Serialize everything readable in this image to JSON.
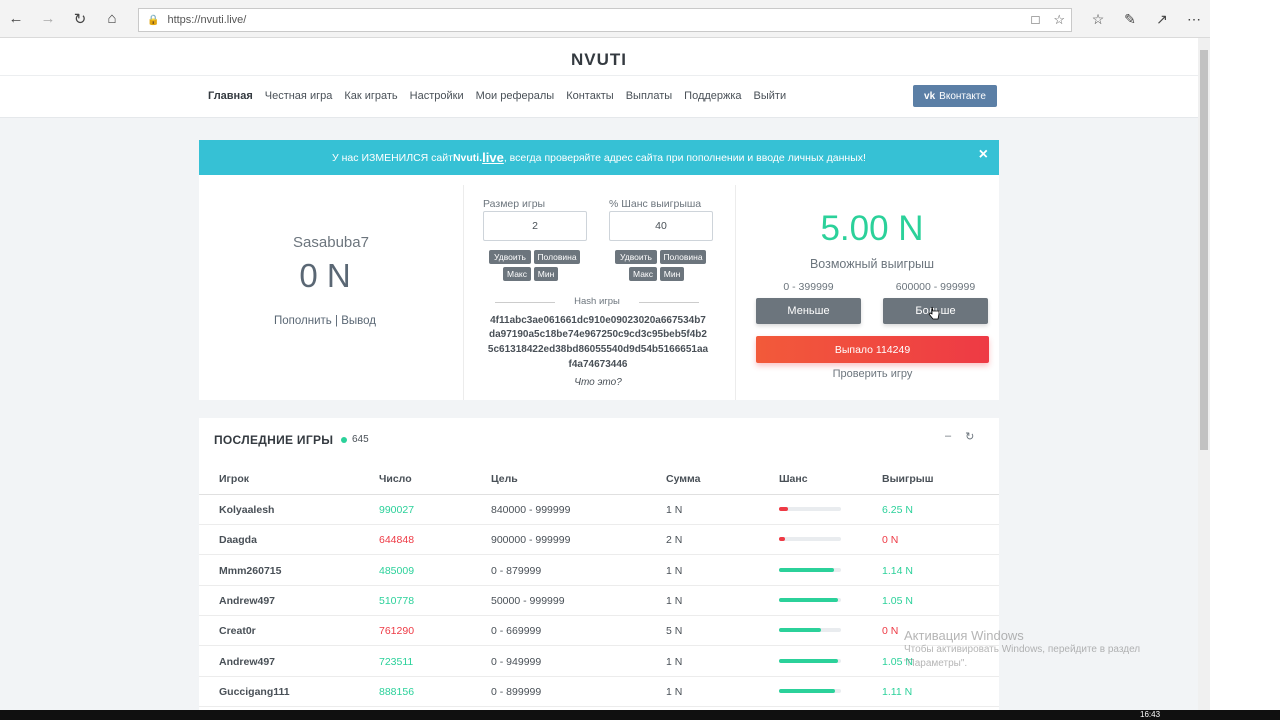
{
  "browser": {
    "url": "https://nvuti.live/",
    "back_icon": "arrow-left",
    "forward_icon": "arrow-right",
    "refresh_icon": "refresh",
    "home_icon": "home"
  },
  "site": {
    "logo": "NVUTI",
    "menu": [
      "Главная",
      "Честная игра",
      "Как играть",
      "Настройки",
      "Мои рефералы",
      "Контакты",
      "Выплаты",
      "Поддержка",
      "Выйти"
    ],
    "vk_label": "Вконтакте"
  },
  "alert": {
    "before": "У нас ИЗМЕНИЛСЯ сайт ",
    "site_a": "Nvuti.",
    "site_b": "live",
    "after": ", всегда проверяйте адрес сайта при пополнении и вводе личных данных!",
    "close": "×"
  },
  "user": {
    "name": "Sasabuba7",
    "balance": "0 N",
    "deposit": "Пополнить",
    "separator": "|",
    "withdraw": "Вывод"
  },
  "game": {
    "size_label": "Размер игры",
    "size_value": "2",
    "chance_label": "% Шанс выигрыша",
    "chance_value": "40",
    "btn_double": "Удвоить",
    "btn_half": "Половина",
    "btn_max": "Макс",
    "btn_min": "Мин",
    "hash_label": "Hash игры",
    "hash_lines": [
      "4f11abc3ae061661dc910e09023020a667534b7",
      "da97190a5c18be74e967250c9cd3c95beb5f4b2",
      "5c61318422ed38bd86055540d9d54b5166651aa",
      "f4a74673446"
    ],
    "what": "Что это?",
    "possible_win": "5.00 N",
    "possible_win_label": "Возможный выигрыш",
    "range_low": "0 - 399999",
    "range_high": "600000 - 999999",
    "btn_less": "Меньше",
    "btn_more": "Больше",
    "result": "Выпало 114249",
    "check": "Проверить игру"
  },
  "recent": {
    "title": "ПОСЛЕДНИЕ ИГРЫ",
    "online": "645",
    "columns": [
      "Игрок",
      "Число",
      "Цель",
      "Сумма",
      "Шанс",
      "Выигрыш"
    ],
    "rows": [
      {
        "player": "Kolyaalesh",
        "number": "990027",
        "target": "840000 - 999999",
        "amount": "1 N",
        "chance": 0.15,
        "win": "6.25 N",
        "won": true
      },
      {
        "player": "Daagda",
        "number": "644848",
        "target": "900000 - 999999",
        "amount": "2 N",
        "chance": 0.1,
        "win": "0 N",
        "won": false
      },
      {
        "player": "Mmm260715",
        "number": "485009",
        "target": "0 - 879999",
        "amount": "1 N",
        "chance": 0.88,
        "win": "1.14 N",
        "won": true
      },
      {
        "player": "Andrew497",
        "number": "510778",
        "target": "50000 - 999999",
        "amount": "1 N",
        "chance": 0.95,
        "win": "1.05 N",
        "won": true
      },
      {
        "player": "Creat0r",
        "number": "761290",
        "target": "0 - 669999",
        "amount": "5 N",
        "chance": 0.67,
        "win": "0 N",
        "won": false
      },
      {
        "player": "Andrew497",
        "number": "723511",
        "target": "0 - 949999",
        "amount": "1 N",
        "chance": 0.95,
        "win": "1.05 N",
        "won": true
      },
      {
        "player": "Guccigang111",
        "number": "888156",
        "target": "0 - 899999",
        "amount": "1 N",
        "chance": 0.9,
        "win": "1.11 N",
        "won": true
      }
    ]
  },
  "watermark": {
    "title": "Активация Windows",
    "sub": "Чтобы активировать Windows, перейдите в раздел \"Параметры\"."
  },
  "taskbar": {
    "clock": "16:43"
  },
  "colors": {
    "green": "#2bd19a",
    "red": "#ee3a45",
    "alert": "#36c1d5",
    "vk": "#5b7fa6"
  }
}
